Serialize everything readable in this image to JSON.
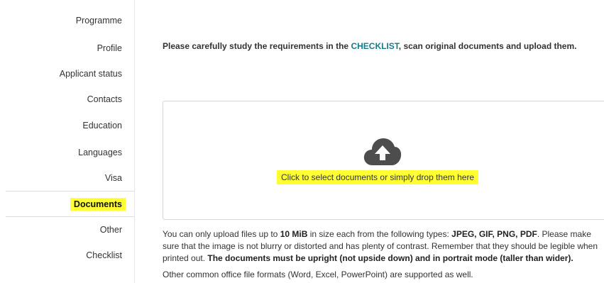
{
  "sidebar": {
    "items": [
      {
        "label": "Programme"
      },
      {
        "label": "Profile"
      },
      {
        "label": "Applicant status"
      },
      {
        "label": "Contacts"
      },
      {
        "label": "Education"
      },
      {
        "label": "Languages"
      },
      {
        "label": "Visa"
      },
      {
        "label": "Documents",
        "active": true
      },
      {
        "label": "Other"
      },
      {
        "label": "Checklist"
      }
    ]
  },
  "main": {
    "intro_before": "Please carefully study the requirements in the ",
    "intro_link": "CHECKLIST",
    "intro_after": ", scan original documents and upload them.",
    "dropzone": {
      "icon": "cloud-upload-icon",
      "text": "Click to select documents or simply drop them here"
    },
    "info": {
      "part1": "You can only upload files up to ",
      "size": "10 MiB",
      "part2": " in size each from the following types: ",
      "types": "JPEG, GIF, PNG, PDF",
      "part3": ". Please make sure that the image is not blurry or distorted and has plenty of contrast. Remember that they should be legible when printed out. ",
      "bold_note": "The documents must be upright (not upside down) and in portrait mode (taller than wider)."
    },
    "formats_note": "Other common office file formats (Word, Excel, PowerPoint) are supported as well."
  },
  "colors": {
    "highlight": "#ffff33",
    "link": "#1a7a8a",
    "icon": "#4d4d4d"
  }
}
